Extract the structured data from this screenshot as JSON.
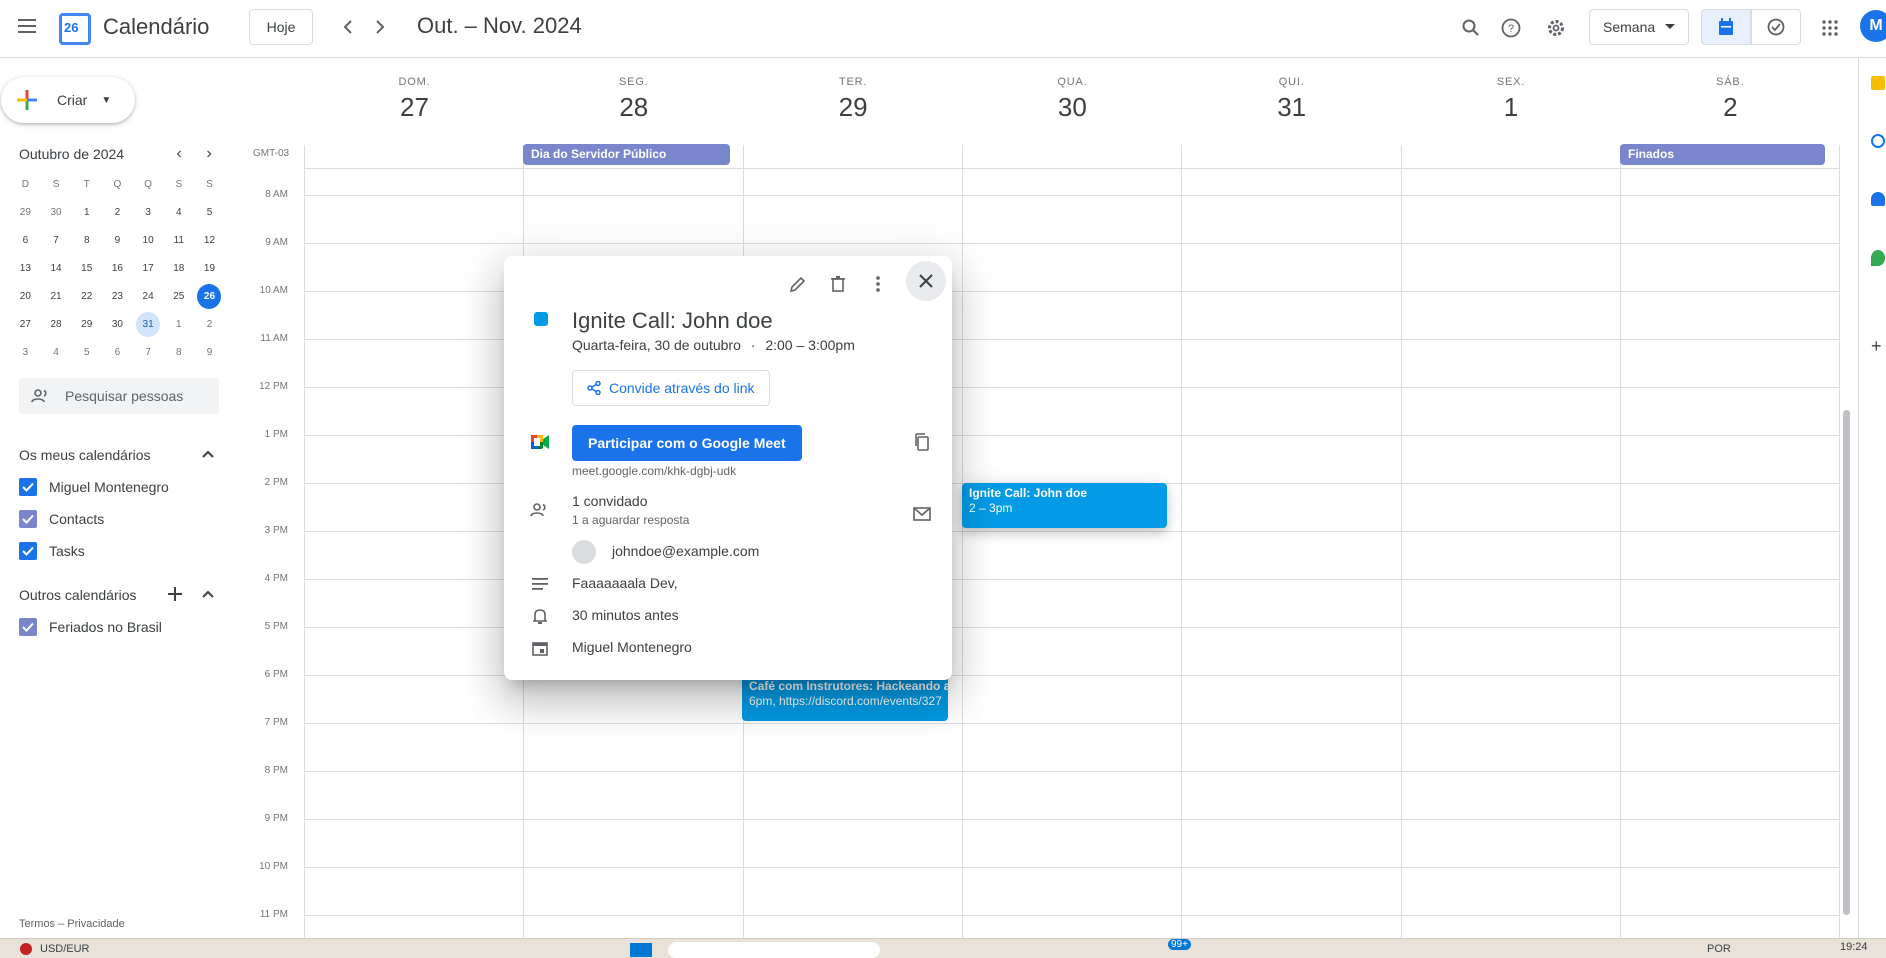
{
  "header": {
    "app_title": "Calendário",
    "logo_day": "26",
    "today_label": "Hoje",
    "period": "Out. – Nov. 2024",
    "view_label": "Semana",
    "avatar_letter": "M"
  },
  "sidebar": {
    "create_label": "Criar",
    "mini_month": "Outubro de 2024",
    "weekday_headers": [
      "D",
      "S",
      "T",
      "Q",
      "Q",
      "S",
      "S"
    ],
    "weeks": [
      [
        "29",
        "30",
        "1",
        "2",
        "3",
        "4",
        "5"
      ],
      [
        "6",
        "7",
        "8",
        "9",
        "10",
        "11",
        "12"
      ],
      [
        "13",
        "14",
        "15",
        "16",
        "17",
        "18",
        "19"
      ],
      [
        "20",
        "21",
        "22",
        "23",
        "24",
        "25",
        "26"
      ],
      [
        "27",
        "28",
        "29",
        "30",
        "31",
        "1",
        "2"
      ],
      [
        "3",
        "4",
        "5",
        "6",
        "7",
        "8",
        "9"
      ]
    ],
    "search_people": "Pesquisar pessoas",
    "my_calendars_title": "Os meus calendários",
    "my_calendars": [
      {
        "label": "Miguel Montenegro",
        "color": "#1a73e8"
      },
      {
        "label": "Contacts",
        "color": "#7986cb"
      },
      {
        "label": "Tasks",
        "color": "#1a73e8"
      }
    ],
    "other_calendars_title": "Outros calendários",
    "other_calendars": [
      {
        "label": "Feriados no Brasil",
        "color": "#7986cb"
      }
    ],
    "footer": "Termos – Privacidade"
  },
  "week": {
    "timezone": "GMT-03",
    "days": [
      {
        "name": "DOM.",
        "date": "27"
      },
      {
        "name": "SEG.",
        "date": "28"
      },
      {
        "name": "TER.",
        "date": "29"
      },
      {
        "name": "QUA.",
        "date": "30"
      },
      {
        "name": "QUI.",
        "date": "31"
      },
      {
        "name": "SEX.",
        "date": "1"
      },
      {
        "name": "SÁB.",
        "date": "2"
      }
    ],
    "hours": [
      "8 AM",
      "9 AM",
      "10 AM",
      "11 AM",
      "12 PM",
      "1 PM",
      "2 PM",
      "3 PM",
      "4 PM",
      "5 PM",
      "6 PM",
      "7 PM",
      "8 PM",
      "9 PM",
      "10 PM",
      "11 PM"
    ],
    "all_day_events": [
      {
        "title": "Dia do Servidor Público",
        "day": 1
      },
      {
        "title": "Finados",
        "day": 6
      }
    ],
    "events": [
      {
        "title": "Ignite Call: John doe",
        "time": "2 – 3pm"
      },
      {
        "title": "Café com Instrutores: Hackeando a ",
        "time": "6pm, https://discord.com/events/327"
      }
    ]
  },
  "popup": {
    "title": "Ignite Call: John doe",
    "date": "Quarta-feira, 30 de outubro",
    "time": "2:00 – 3:00pm",
    "invite_link_label": "Convide através do link",
    "meet_button": "Participar com o Google Meet",
    "meet_url": "meet.google.com/khk-dgbj-udk",
    "guests_count": "1 convidado",
    "guests_status": "1 a aguardar resposta",
    "guest_email": "johndoe@example.com",
    "description": "Faaaaaaala Dev,",
    "reminder": "30 minutos antes",
    "organizer": "Miguel Montenegro",
    "event_color": "#039be5"
  },
  "taskbar": {
    "ticker": "USD/EUR",
    "lang": "POR",
    "clock": "19:24",
    "badge": "99+"
  }
}
